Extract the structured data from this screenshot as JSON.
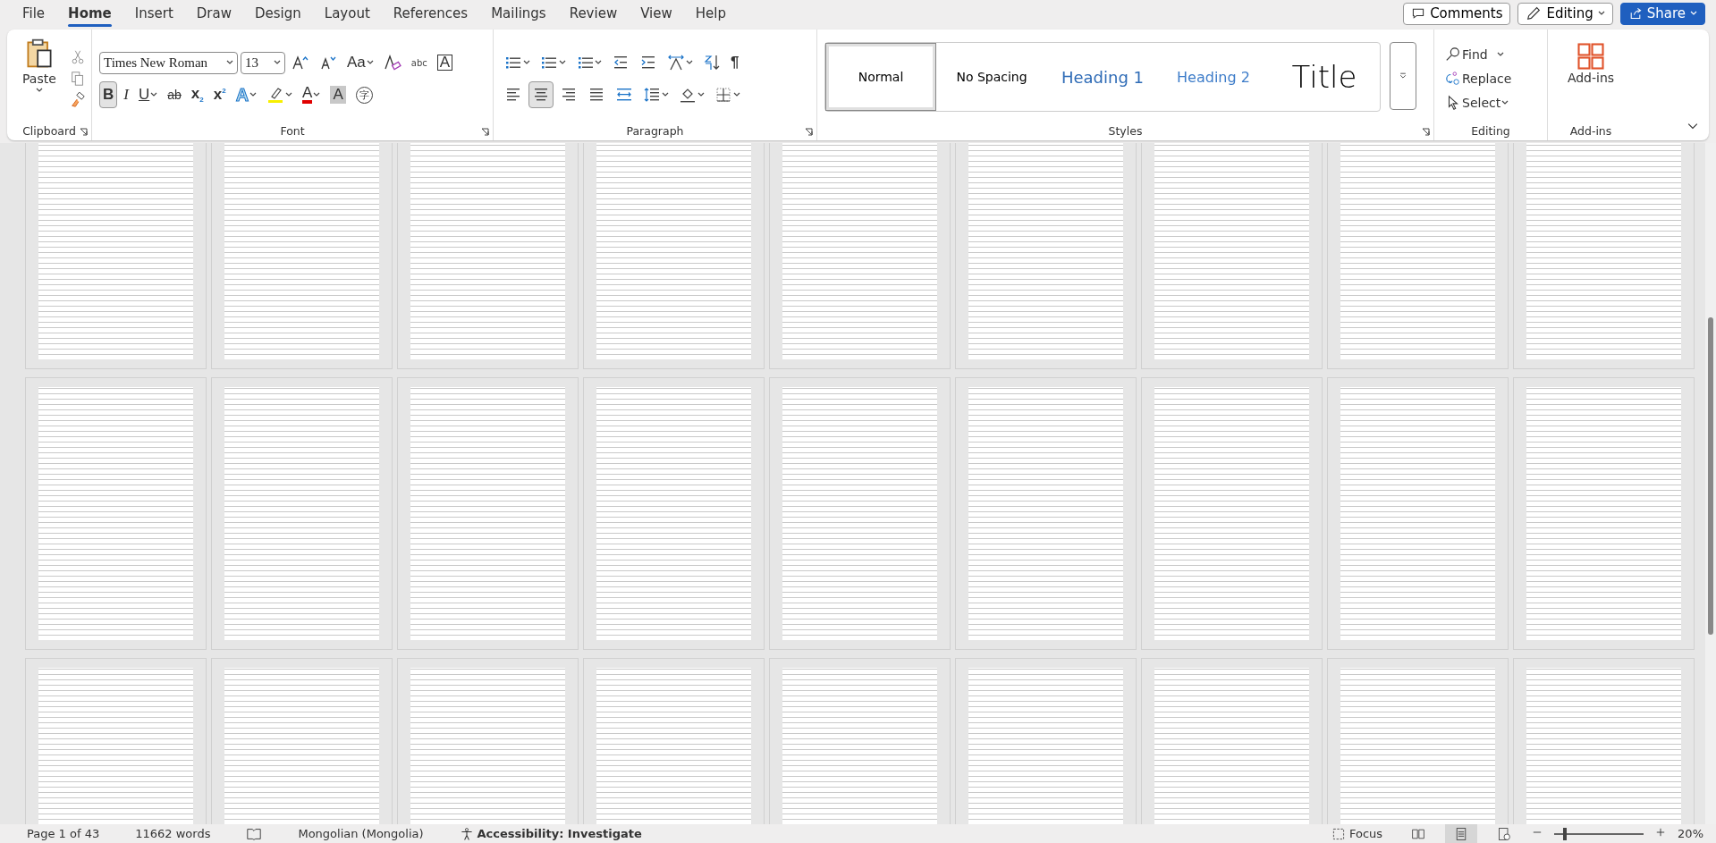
{
  "menu_tabs": [
    {
      "label": "File",
      "selected": false
    },
    {
      "label": "Home",
      "selected": true
    },
    {
      "label": "Insert",
      "selected": false
    },
    {
      "label": "Draw",
      "selected": false
    },
    {
      "label": "Design",
      "selected": false
    },
    {
      "label": "Layout",
      "selected": false
    },
    {
      "label": "References",
      "selected": false
    },
    {
      "label": "Mailings",
      "selected": false
    },
    {
      "label": "Review",
      "selected": false
    },
    {
      "label": "View",
      "selected": false
    },
    {
      "label": "Help",
      "selected": false
    }
  ],
  "top_buttons": {
    "comments": "Comments",
    "editing": "Editing",
    "share": "Share"
  },
  "clipboard": {
    "paste": "Paste",
    "label": "Clipboard"
  },
  "font": {
    "name": "Times New Roman",
    "size": "13",
    "label": "Font",
    "row1": [
      {
        "kind": "grow"
      },
      {
        "kind": "shrink"
      },
      {
        "kind": "case",
        "text": "Aa"
      },
      {
        "kind": "clear"
      },
      {
        "kind": "effects",
        "text": "abc"
      },
      {
        "kind": "border",
        "text": "A"
      }
    ],
    "row2": [
      {
        "kind": "bold",
        "text": "B",
        "selected": true
      },
      {
        "kind": "italic",
        "text": "I",
        "selected": false
      },
      {
        "kind": "underline",
        "text": "U",
        "selected": false
      },
      {
        "kind": "strike",
        "text": "ab",
        "selected": false
      },
      {
        "kind": "sub",
        "text": "x",
        "index": "2",
        "selected": false
      },
      {
        "kind": "sup",
        "text": "x",
        "index": "2",
        "selected": false
      },
      {
        "kind": "texteffect",
        "text": "A",
        "selected": false
      },
      {
        "kind": "highlight",
        "selected": false
      },
      {
        "kind": "fontcolor",
        "text": "A",
        "selected": false
      },
      {
        "kind": "shade",
        "text": "A",
        "selected": false
      },
      {
        "kind": "enclose",
        "text": "字",
        "selected": false
      }
    ]
  },
  "paragraph": {
    "label": "Paragraph",
    "row1": [
      {
        "kind": "bullets"
      },
      {
        "kind": "numbering"
      },
      {
        "kind": "multilevel"
      },
      {
        "kind": "outdent"
      },
      {
        "kind": "indent"
      },
      {
        "kind": "direction"
      },
      {
        "kind": "sort"
      },
      {
        "kind": "pilcrow",
        "text": "¶"
      }
    ],
    "row2": [
      {
        "kind": "left",
        "selected": false
      },
      {
        "kind": "center",
        "selected": true
      },
      {
        "kind": "right",
        "selected": false
      },
      {
        "kind": "justify",
        "selected": false
      },
      {
        "kind": "distribute",
        "selected": false
      },
      {
        "kind": "spacing",
        "selected": false
      },
      {
        "kind": "fill",
        "selected": false
      },
      {
        "kind": "borders",
        "selected": false
      }
    ]
  },
  "styles": {
    "label": "Styles",
    "items": [
      {
        "label": "Normal",
        "kind": "normal",
        "selected": true
      },
      {
        "label": "No Spacing",
        "kind": "nospacing",
        "selected": false
      },
      {
        "label": "Heading 1",
        "kind": "h1",
        "selected": false
      },
      {
        "label": "Heading 2",
        "kind": "h2",
        "selected": false
      },
      {
        "label": "Title",
        "kind": "title",
        "selected": false
      }
    ]
  },
  "editing": {
    "label": "Editing",
    "find": "Find",
    "replace": "Replace",
    "select": "Select"
  },
  "addins": {
    "button": "Add-ins",
    "label": "Add-ins"
  },
  "status_bar": {
    "page": "Page 1 of 43",
    "words": "11662 words",
    "language": "Mongolian (Mongolia)",
    "accessibility": "Accessibility: Investigate",
    "focus": "Focus",
    "views": [
      {
        "kind": "read",
        "selected": false
      },
      {
        "kind": "print",
        "selected": true
      },
      {
        "kind": "web",
        "selected": false
      }
    ],
    "zoom_slider": {
      "level": 0.1
    },
    "zoom": "20%"
  }
}
